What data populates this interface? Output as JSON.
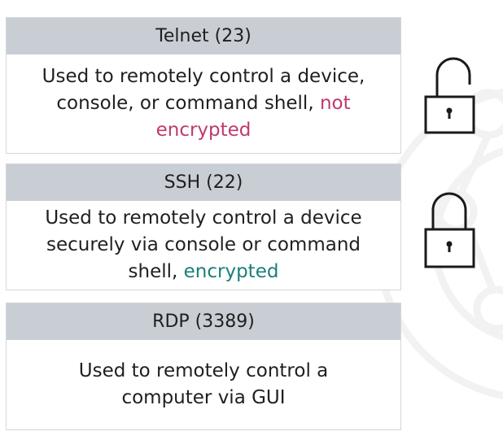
{
  "colors": {
    "header_bg": "#c9ced5",
    "not_encrypted": "#c0396f",
    "encrypted": "#1a7f7a",
    "text": "#1f1f1f"
  },
  "cards": [
    {
      "title": "Telnet (23)",
      "desc_line1": "Used to remotely control a device,",
      "desc_line2_prefix": "console, or command shell,",
      "desc_highlight": "not encrypted",
      "lock_icon": "unlocked-padlock-icon"
    },
    {
      "title": "SSH (22)",
      "desc_line1": "Used to remotely control a device",
      "desc_line2": "securely via console or command",
      "desc_line3_prefix": "shell,",
      "desc_highlight": "encrypted",
      "lock_icon": "locked-padlock-icon"
    },
    {
      "title": "RDP (3389)",
      "desc_line1": "Used to remotely control a",
      "desc_line2": "computer via GUI"
    }
  ]
}
